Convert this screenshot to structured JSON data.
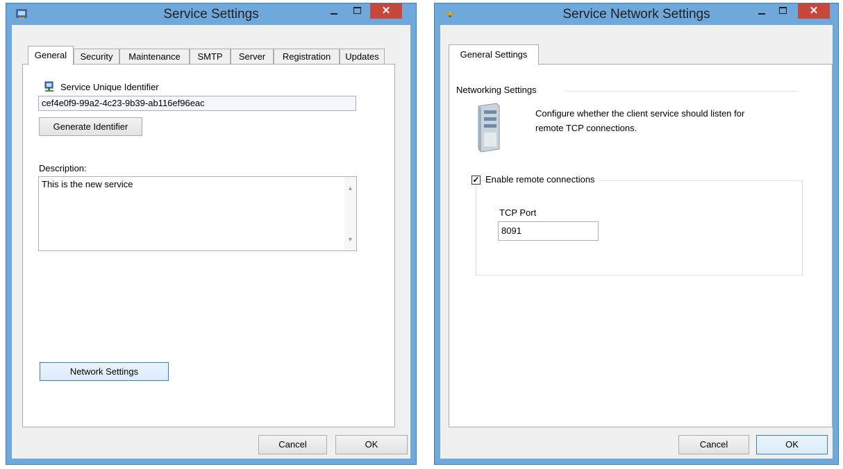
{
  "left_window": {
    "title": "Service Settings",
    "tabs": [
      "General",
      "Security",
      "Maintenance",
      "SMTP",
      "Server",
      "Registration",
      "Updates"
    ],
    "active_tab": "General",
    "identifier_label": "Service Unique Identifier",
    "identifier_value": "cef4e0f9-99a2-4c23-9b39-ab116ef96eac",
    "generate_button": "Generate Identifier",
    "description_label": "Description:",
    "description_value": "This is the new service",
    "network_button": "Network Settings",
    "cancel_button": "Cancel",
    "ok_button": "OK",
    "close_glyph": "✕"
  },
  "right_window": {
    "title": "Service Network Settings",
    "tab": "General Settings",
    "group_label": "Networking Settings",
    "info_text_line1": "Configure whether the client service should listen for",
    "info_text_line2": "remote TCP connections.",
    "checkbox_label": "Enable remote connections",
    "checkbox_checked": true,
    "checkbox_glyph": "✓",
    "port_label": "TCP Port",
    "port_value": "8091",
    "cancel_button": "Cancel",
    "ok_button": "OK",
    "close_glyph": "✕"
  },
  "colors": {
    "frame": "#6fa9dc",
    "close": "#c7483a",
    "panel": "#f0f0f0"
  },
  "icons": [
    "service-app-icon",
    "pin-icon",
    "network-computer-icon",
    "server-icon",
    "minimize-icon",
    "maximize-icon",
    "close-icon"
  ]
}
